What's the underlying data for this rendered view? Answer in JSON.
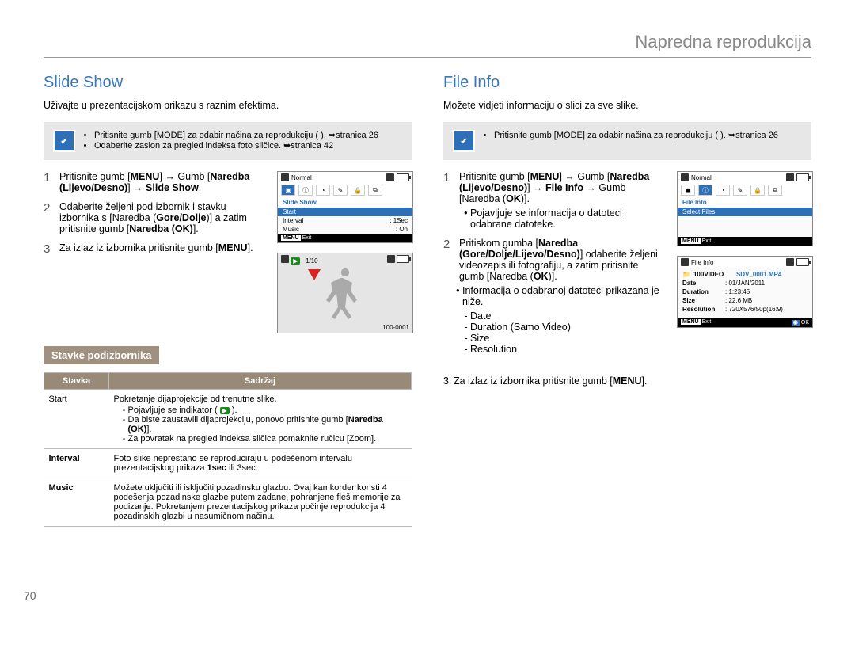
{
  "pageHeader": "Napredna reprodukcija",
  "pageNumber": "70",
  "left": {
    "title": "Slide Show",
    "intro": "Uživajte u prezentacijskom prikazu s raznim efektima.",
    "note": {
      "items": [
        "Pritisnite gumb [MODE] za odabir načina za reprodukciju (   ). ➥stranica 26",
        "Odaberite zaslon za pregled indeksa foto sličice. ➥stranica 42"
      ]
    },
    "steps": [
      {
        "num": "1",
        "html_segments": [
          "Pritisnite gumb [",
          "MENU",
          "] → Gumb [",
          "Naredba (Lijevo/Desno)",
          "] → ",
          "Slide Show",
          "."
        ]
      },
      {
        "num": "2",
        "html_segments": [
          "Odaberite željeni pod izbornik i stavku izbornika s [Naredba (",
          "Gore/Dolje",
          ")] a zatim pritisnite gumb [",
          "Naredba (OK)",
          "]."
        ]
      },
      {
        "num": "3",
        "html_segments": [
          "Za izlaz iz izbornika pritisnite gumb [",
          "MENU",
          "]."
        ]
      }
    ],
    "subHeading": "Stavke podizbornika",
    "table": {
      "headers": [
        "Stavka",
        "Sadržaj"
      ],
      "rows": [
        {
          "key": "Start",
          "boldKey": false,
          "lead": "Pokretanje dijaprojekcije od trenutne slike.",
          "items": [
            "Pojavljuje se indikator (   ).",
            "Da biste zaustavili dijaprojekciju, ponovo pritisnite gumb [Naredba (OK)].",
            "Za povratak na pregled indeksa sličica pomaknite ručicu [Zoom]."
          ]
        },
        {
          "key": "Interval",
          "boldKey": true,
          "lead": "Foto slike neprestano se reproduciraju u podešenom intervalu prezentacijskog prikaza 1sec ili 3sec.",
          "items": []
        },
        {
          "key": "Music",
          "boldKey": true,
          "lead": "Možete uključiti ili isključiti pozadinsku glazbu. Ovaj kamkorder koristi 4 podešenja pozadinske glazbe putem zadane, pohranjene fleš memorije za podizanje. Pokretanjem prezentacijskog prikaza počinje reprodukcija 4 pozadinskih glazbi u nasumičnom načinu.",
          "items": []
        }
      ]
    },
    "camMenu": {
      "topLeftIcon": "photo-mode-icon",
      "topLabel": "Normal",
      "menuTitle": "Slide Show",
      "rows": [
        {
          "label": "Start",
          "value": "",
          "selected": true
        },
        {
          "label": "Interval",
          "value": ": 1Sec",
          "selected": false
        },
        {
          "label": "Music",
          "value": ": On",
          "selected": false
        }
      ],
      "exitLabel": "Exit"
    },
    "camPhoto": {
      "counter": "1/10",
      "fileName": "100-0001"
    }
  },
  "right": {
    "title": "File Info",
    "intro": "Možete vidjeti informaciju o slici za sve slike.",
    "note": {
      "items": [
        "Pritisnite gumb [MODE] za odabir načina za reprodukciju (   ). ➥stranica 26"
      ]
    },
    "steps": [
      {
        "num": "1",
        "body": "Pritisnite gumb [MENU] → Gumb [Naredba (Lijevo/Desno)] → File Info → Gumb [Naredba (OK)].",
        "sub": [
          "Pojavljuje se informacija o datoteci odabrane datoteke."
        ]
      },
      {
        "num": "2",
        "body": "Pritiskom gumba [Naredba (Gore/Dolje/Lijevo/Desno)] odaberite željeni videozapis ili fotografiju, a zatim pritisnite gumb [Naredba (OK)].",
        "sub": [
          "Informacija o odabranoj datoteci prikazana je niže."
        ],
        "list": [
          "Date",
          "Duration (Samo Video)",
          "Size",
          "Resolution"
        ]
      },
      {
        "num": "3",
        "body": "Za izlaz iz izbornika pritisnite gumb [MENU]."
      }
    ],
    "camMenu": {
      "topLabel": "Normal",
      "menuTitle": "File Info",
      "rows": [
        {
          "label": "Select Files",
          "value": "",
          "selected": true
        }
      ],
      "exitLabel": "Exit"
    },
    "camFileInfo": {
      "title": "File Info",
      "folder": "100VIDEO",
      "file": "SDV_0001.MP4",
      "rows": [
        {
          "label": "Date",
          "value": ": 01/JAN/2011"
        },
        {
          "label": "Duration",
          "value": ": 1:23:45"
        },
        {
          "label": "Size",
          "value": ": 22.6 MB"
        },
        {
          "label": "Resolution",
          "value": ": 720X576/50p(16:9)"
        }
      ],
      "exitLabel": "Exit",
      "okLabel": "OK"
    }
  }
}
